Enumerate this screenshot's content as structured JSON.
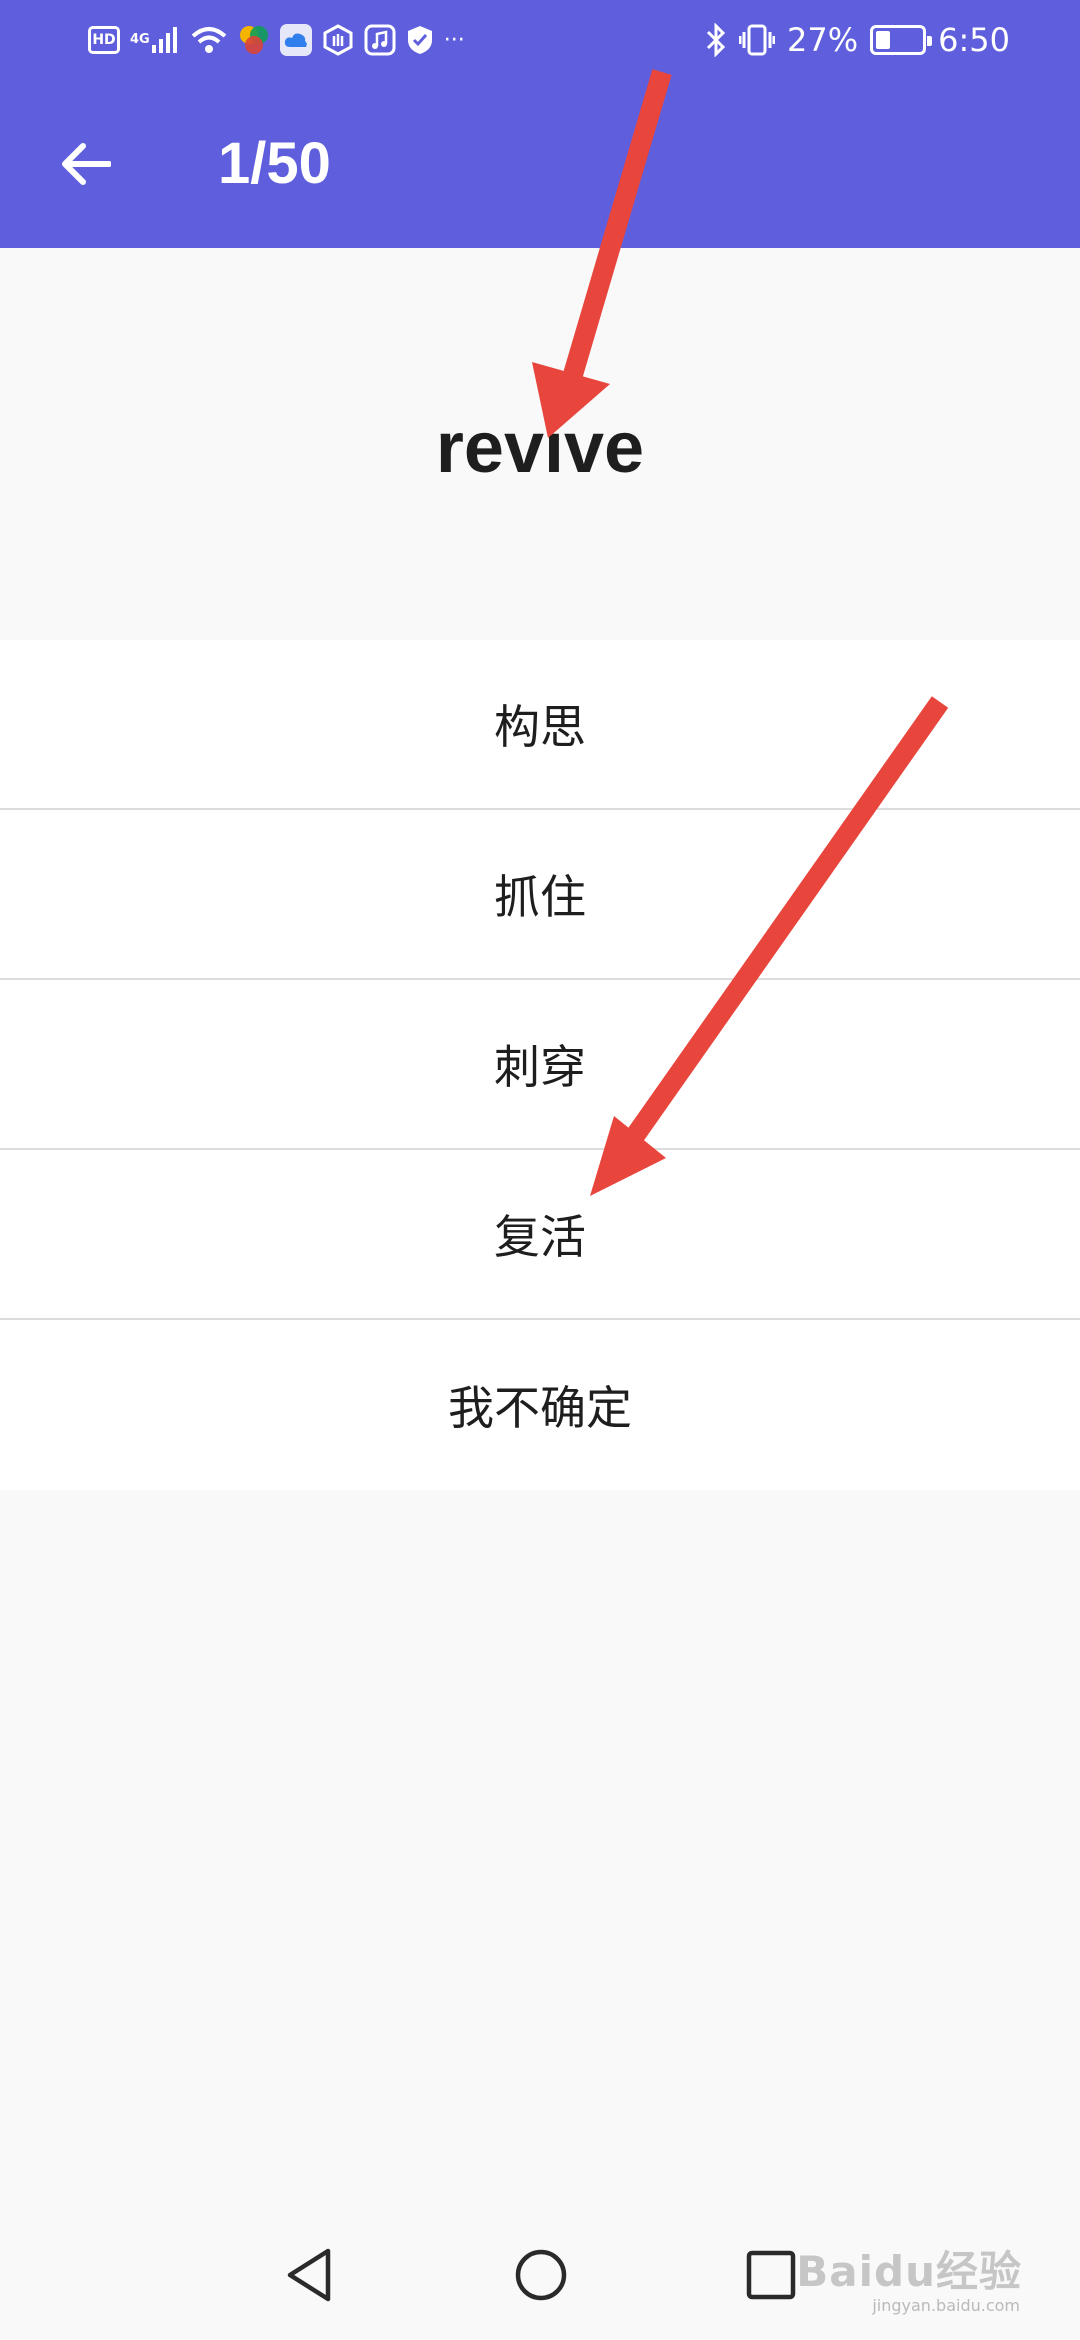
{
  "status_bar": {
    "hd": "HD",
    "network": "4G",
    "more": "···",
    "battery": "27%",
    "battery_level": 0.27,
    "time": "6:50"
  },
  "app_bar": {
    "progress": "1/50",
    "back_icon": "arrow-left-icon"
  },
  "question": {
    "word": "revive"
  },
  "options": [
    {
      "label": "构思"
    },
    {
      "label": "抓住"
    },
    {
      "label": "刺穿"
    },
    {
      "label": "复活"
    },
    {
      "label": "我不确定"
    }
  ],
  "annotations": {
    "arrow_color": "#e8453c"
  },
  "nav_bar": {
    "back_icon": "triangle-back-icon",
    "home_icon": "circle-home-icon",
    "recents_icon": "square-recents-icon"
  },
  "watermark": {
    "text": "Baidu经验",
    "sub": "jingyan.baidu.com"
  },
  "colors": {
    "primary": "#5f5fdd",
    "background": "#f9f9f9",
    "card": "#ffffff",
    "text": "#1e1e1e",
    "divider": "#dcdcdc"
  }
}
